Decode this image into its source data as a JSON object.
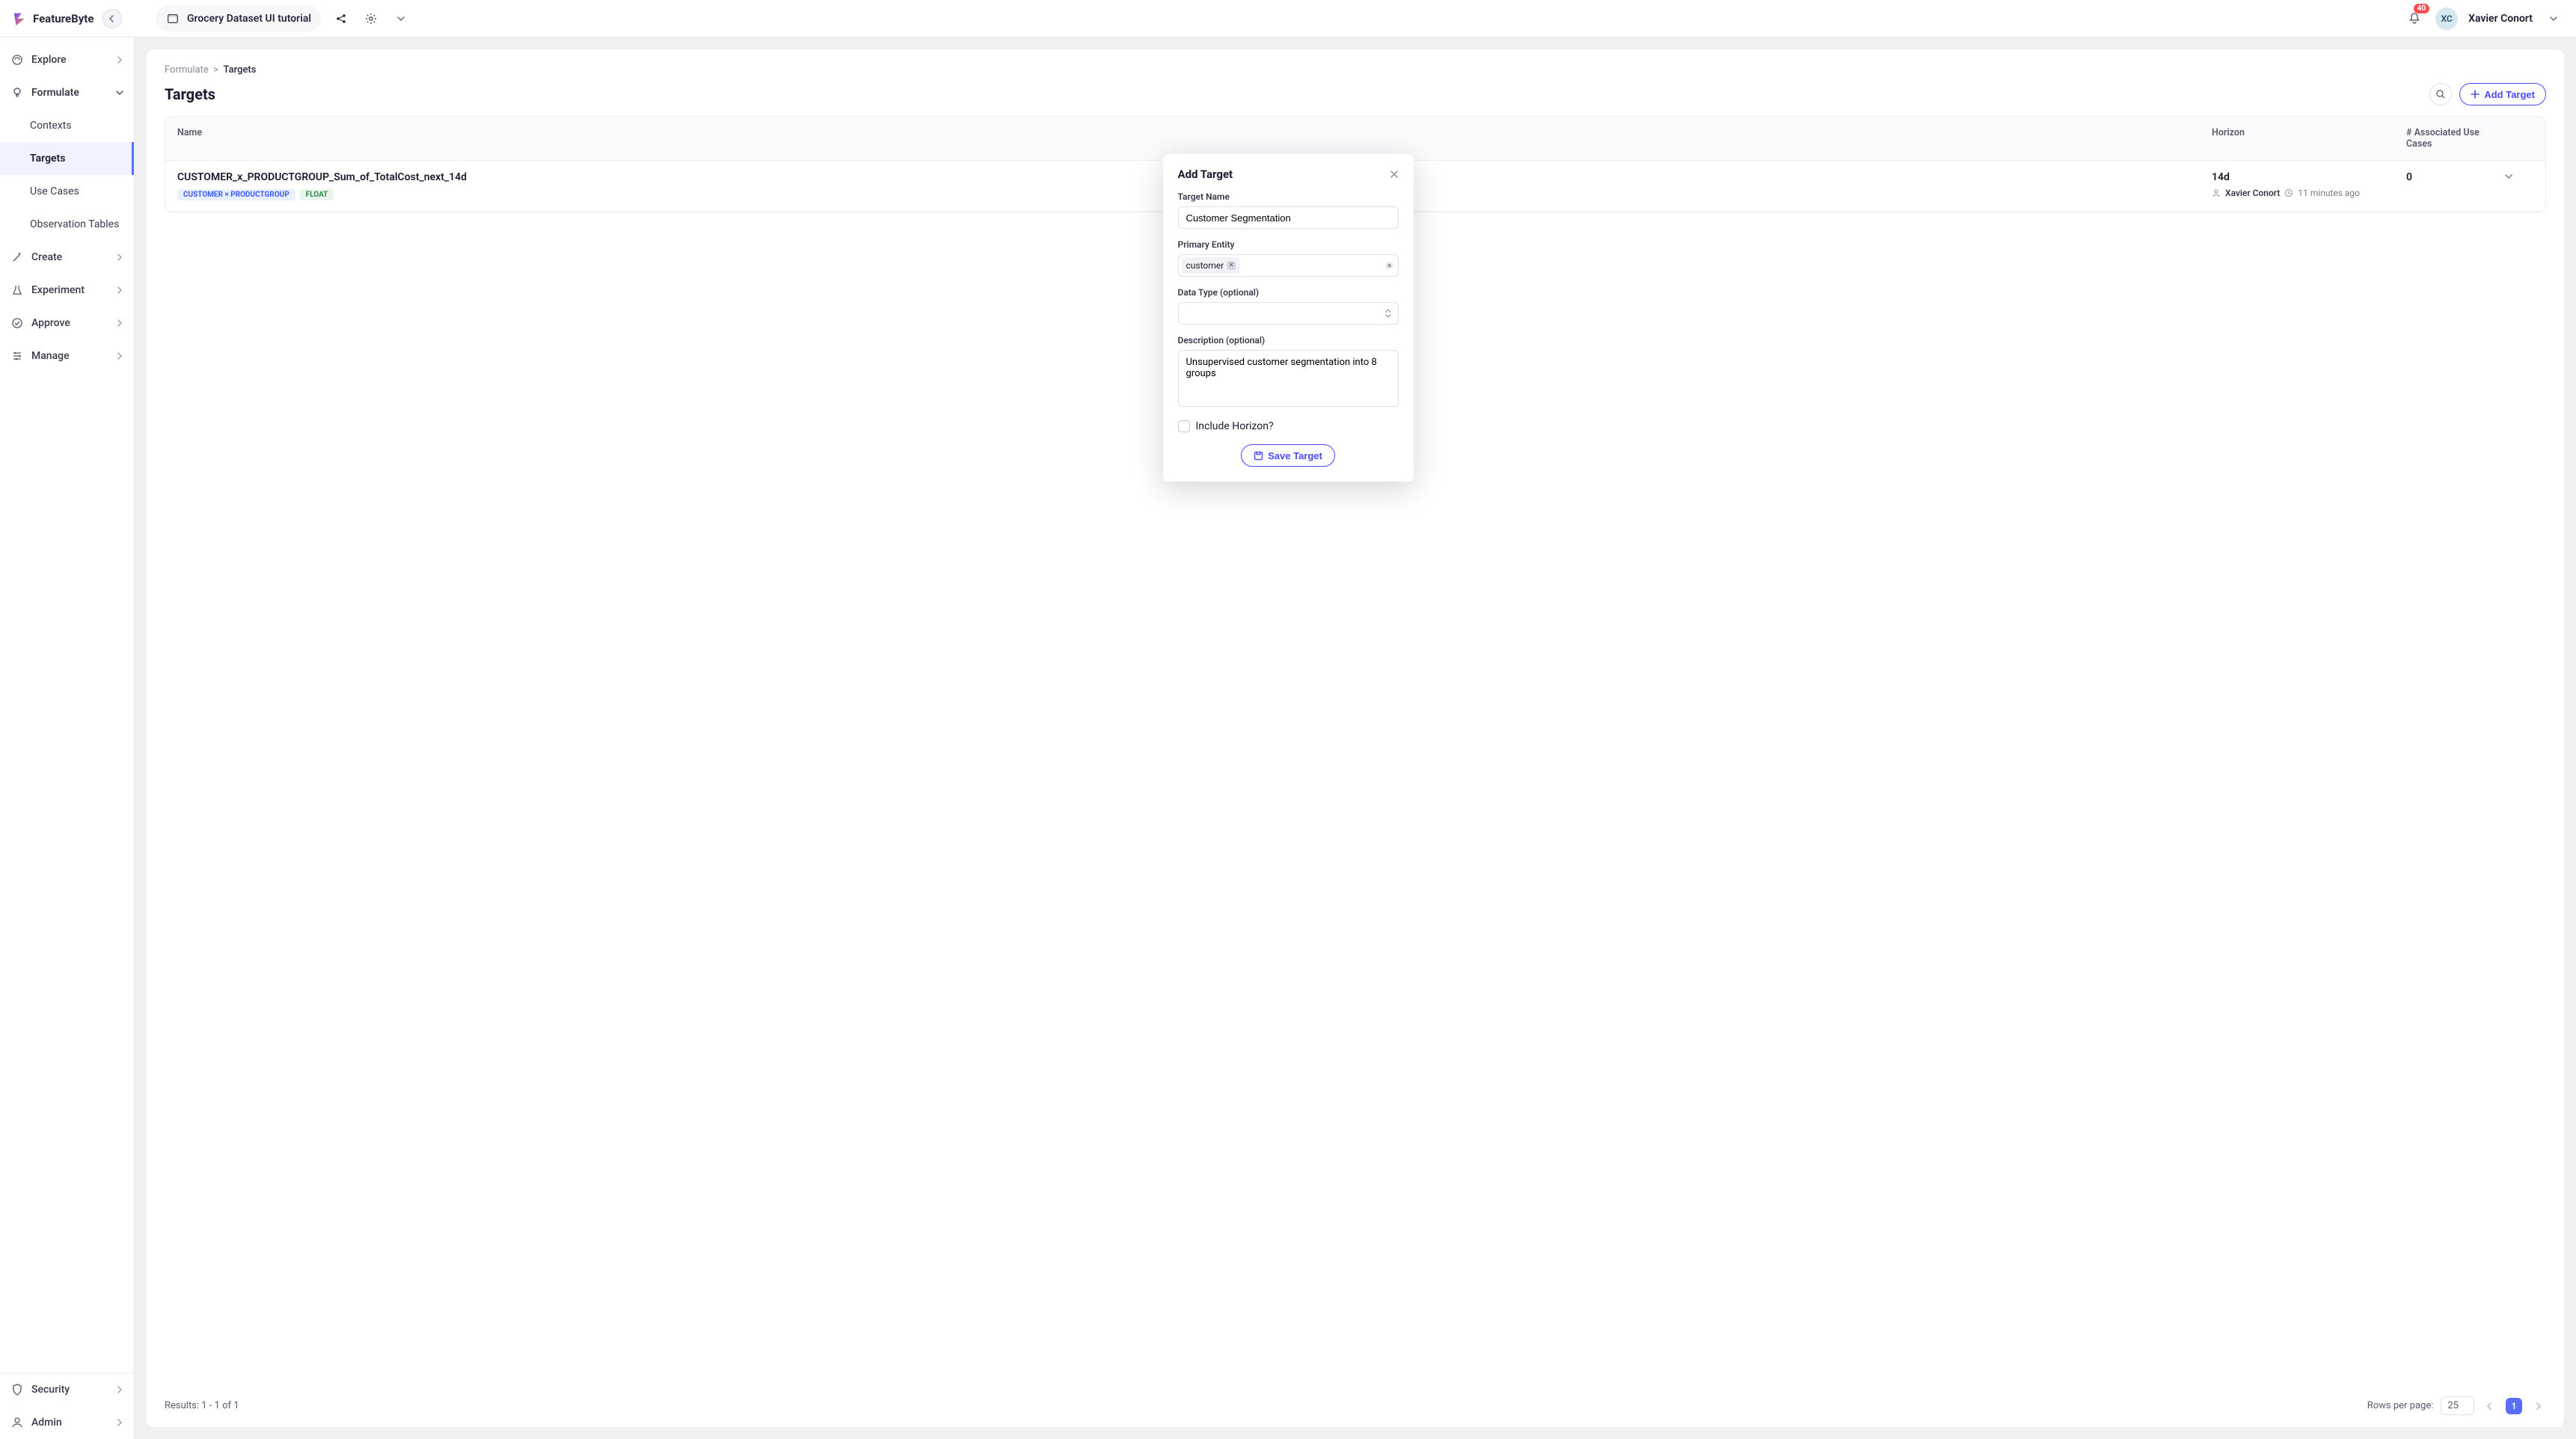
{
  "brand": "FeatureByte",
  "header": {
    "catalog_name": "Grocery Dataset UI tutorial",
    "notification_count": "40",
    "user_initials": "XC",
    "user_name": "Xavier Conort"
  },
  "sidebar": {
    "top": [
      {
        "id": "explore",
        "label": "Explore",
        "icon": "brain-icon",
        "chev": true
      },
      {
        "id": "formulate",
        "label": "Formulate",
        "icon": "bulb-icon",
        "expanded": true,
        "children": [
          {
            "id": "contexts",
            "label": "Contexts"
          },
          {
            "id": "targets",
            "label": "Targets",
            "active": true
          },
          {
            "id": "use-cases",
            "label": "Use Cases"
          },
          {
            "id": "observation-tables",
            "label": "Observation Tables"
          }
        ]
      },
      {
        "id": "create",
        "label": "Create",
        "icon": "wand-icon",
        "chev": true
      },
      {
        "id": "experiment",
        "label": "Experiment",
        "icon": "flask-icon",
        "chev": true
      },
      {
        "id": "approve",
        "label": "Approve",
        "icon": "check-circle-icon",
        "chev": true
      },
      {
        "id": "manage",
        "label": "Manage",
        "icon": "sliders-icon",
        "chev": true
      }
    ],
    "bottom": [
      {
        "id": "security",
        "label": "Security",
        "icon": "shield-icon",
        "chev": true
      },
      {
        "id": "admin",
        "label": "Admin",
        "icon": "user-icon",
        "chev": true
      }
    ]
  },
  "crumbs": {
    "root": "Formulate",
    "leaf": "Targets"
  },
  "page": {
    "title": "Targets",
    "add_button": "Add Target"
  },
  "table": {
    "head": {
      "name": "Name",
      "horizon": "Horizon",
      "assoc": "# Associated Use Cases"
    },
    "rows": [
      {
        "name": "CUSTOMER_x_PRODUCTGROUP_Sum_of_TotalCost_next_14d",
        "entity_tag": "CUSTOMER × PRODUCTGROUP",
        "type_tag": "FLOAT",
        "horizon": "14d",
        "author": "Xavier Conort",
        "age": "11 minutes ago",
        "assoc": "0"
      }
    ]
  },
  "footer": {
    "results": "Results: 1 - 1 of 1",
    "rows_per_page_label": "Rows per page:",
    "rows_per_page": "25",
    "page_current": "1"
  },
  "modal": {
    "title": "Add Target",
    "labels": {
      "target_name": "Target Name",
      "primary_entity": "Primary Entity",
      "data_type": "Data Type (optional)",
      "description": "Description (optional)",
      "include_horizon": "Include Horizon?",
      "save": "Save Target"
    },
    "values": {
      "target_name": "Customer Segmentation",
      "primary_entity_chip": "customer",
      "description": "Unsupervised customer segmentation into 8 groups"
    }
  }
}
